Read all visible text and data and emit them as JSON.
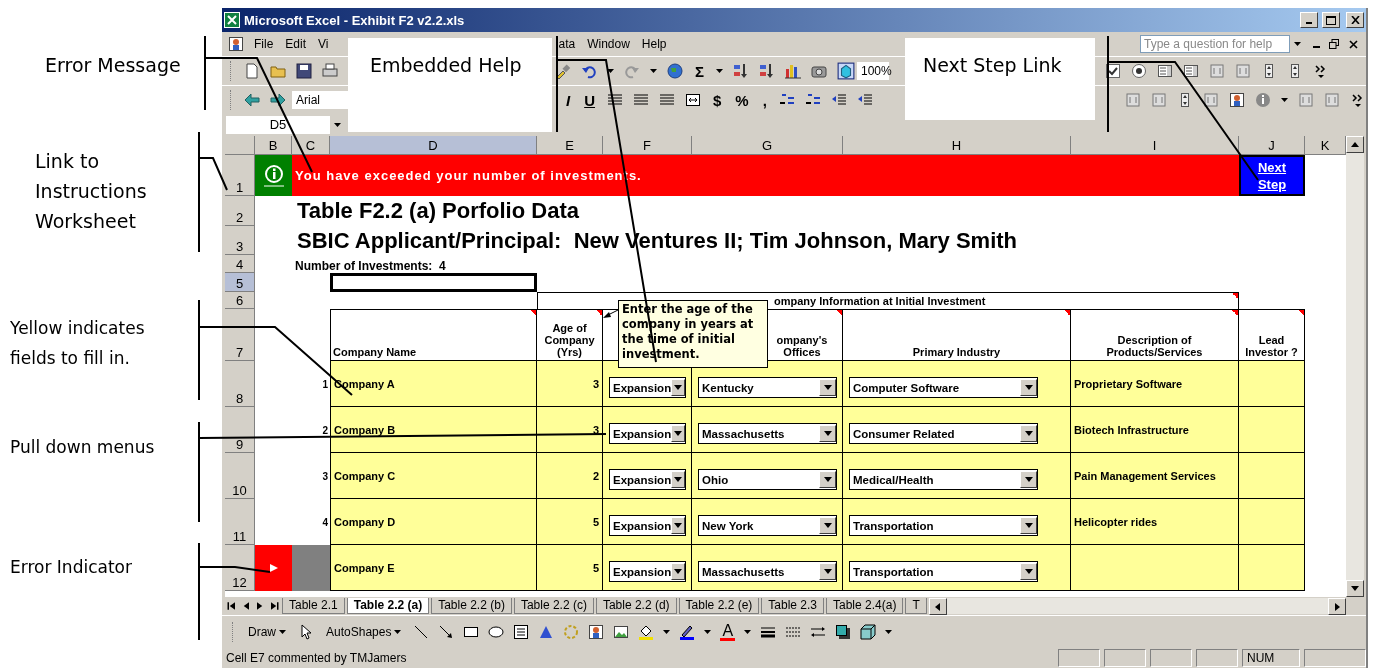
{
  "annotations": [
    {
      "text": "Error Message"
    },
    {
      "text": "Link to Instructions Worksheet"
    },
    {
      "text": "Yellow indicates fields to fill in."
    },
    {
      "text": "Pull down menus"
    },
    {
      "text": "Error Indicator"
    },
    {
      "text": "Embedded Help"
    },
    {
      "text": "Next Step Link"
    }
  ],
  "window": {
    "title": "Microsoft Excel - Exhibit F2 v2.2.xls"
  },
  "menu_bar": {
    "items": [
      "File",
      "Edit",
      "Vi",
      "ata",
      "Window",
      "Help"
    ],
    "help_box": {
      "placeholder": "Type a question for help"
    }
  },
  "standard_toolbar": {
    "sum": "Σ",
    "zoom": "100%"
  },
  "formatting_toolbar": {
    "font": "Arial",
    "italic": "I",
    "underline": "U",
    "currency": "$",
    "percent": "%",
    "comma": ","
  },
  "name_box": "D5",
  "sheet": {
    "columns": [
      {
        "label": "B",
        "selected": false
      },
      {
        "label": "C",
        "selected": false
      },
      {
        "label": "D",
        "selected": true
      },
      {
        "label": "E",
        "selected": false
      },
      {
        "label": "F",
        "selected": false
      },
      {
        "label": "G",
        "selected": false
      },
      {
        "label": "H",
        "selected": false
      },
      {
        "label": "I",
        "selected": false
      },
      {
        "label": "J",
        "selected": false
      },
      {
        "label": "K",
        "selected": false
      }
    ],
    "rows": [
      {
        "label": "1",
        "selected": false
      },
      {
        "label": "2",
        "selected": false
      },
      {
        "label": "3",
        "selected": false
      },
      {
        "label": "4",
        "selected": false
      },
      {
        "label": "5",
        "selected": true
      },
      {
        "label": "6",
        "selected": false
      },
      {
        "label": "7",
        "selected": false
      },
      {
        "label": "8",
        "selected": false
      },
      {
        "label": "9",
        "selected": false
      },
      {
        "label": "10",
        "selected": false
      },
      {
        "label": "11",
        "selected": false
      },
      {
        "label": "12",
        "selected": false
      }
    ],
    "error_message": "You have exceeded your number of investments.",
    "next_step_link": "Next Step",
    "title": "Table F2.2 (a) Porfolio Data",
    "subtitle": "SBIC Applicant/Principal:  New Ventures II; Tim Johnson, Mary Smith",
    "investment_count": "Number of Investments:  4",
    "group_header": "ompany Information at Initial Investment",
    "table_headers": {
      "company_name": "Company Name",
      "age": "Age of Company (Yrs)",
      "offices": "ompany's Offices",
      "industry": "Primary Industry",
      "description": "Description of Products/Services",
      "lead_investor": "Lead Investor ?"
    },
    "table_rows": [
      {
        "number": "1",
        "company": "Company A",
        "age": "3",
        "stage": "Expansion",
        "state": "Kentucky",
        "industry": "Computer Software",
        "description": "Proprietary Software",
        "error": false
      },
      {
        "number": "2",
        "company": "Company B",
        "age": "3",
        "stage": "Expansion",
        "state": "Massachusetts",
        "industry": "Consumer Related",
        "description": "Biotech Infrastructure",
        "error": false
      },
      {
        "number": "3",
        "company": "Company C",
        "age": "2",
        "stage": "Expansion",
        "state": "Ohio",
        "industry": "Medical/Health",
        "description": "Pain Management Services",
        "error": false
      },
      {
        "number": "4",
        "company": "Company D",
        "age": "5",
        "stage": "Expansion",
        "state": "New York",
        "industry": "Transportation",
        "description": "Helicopter rides",
        "error": false
      },
      {
        "company": "Company E",
        "age": "5",
        "stage": "Expansion",
        "state": "Massachusetts",
        "industry": "Transportation",
        "error": true
      }
    ],
    "comment": "Enter the age of the company in years at the time of initial investment."
  },
  "sheet_tabs": [
    {
      "label": "Table 2.1",
      "selected": false
    },
    {
      "label": "Table 2.2 (a)",
      "selected": true
    },
    {
      "label": "Table 2.2 (b)",
      "selected": false
    },
    {
      "label": "Table 2.2 (c)",
      "selected": false
    },
    {
      "label": "Table 2.2 (d)",
      "selected": false
    },
    {
      "label": "Table 2.2 (e)",
      "selected": false
    },
    {
      "label": "Table 2.3",
      "selected": false
    },
    {
      "label": "Table 2.4(a)",
      "selected": false
    },
    {
      "label": "T",
      "selected": false
    }
  ],
  "draw_toolbar": {
    "draw": "Draw",
    "autoshapes": "AutoShapes",
    "font_color": "A"
  },
  "status_bar": {
    "message": "Cell E7 commented by TMJamers",
    "indicator": "NUM"
  }
}
